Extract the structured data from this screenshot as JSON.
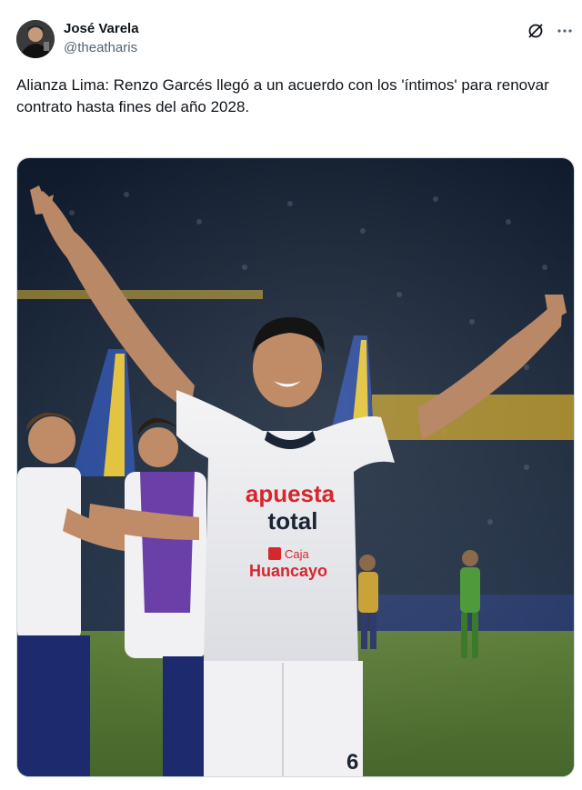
{
  "author": {
    "display_name": "José Varela",
    "handle": "@theatharis"
  },
  "icons": {
    "grok": "grok-icon",
    "more": "more-options-icon"
  },
  "tweet": {
    "text": "Alianza Lima: Renzo Garcés llegó a un acuerdo con los 'íntimos' para renovar contrato hasta fines del año 2028."
  },
  "photo": {
    "shirt_sponsor_line1": "apuesta",
    "shirt_sponsor_line2": "total",
    "shirt_sponsor_line3": "Caja",
    "shirt_sponsor_line4": "Huancayo",
    "shirt_number": "6"
  },
  "colors": {
    "text_primary": "#0f1419",
    "text_secondary": "#536471",
    "border": "#cfd9de",
    "sponsor_red": "#d6262e"
  }
}
